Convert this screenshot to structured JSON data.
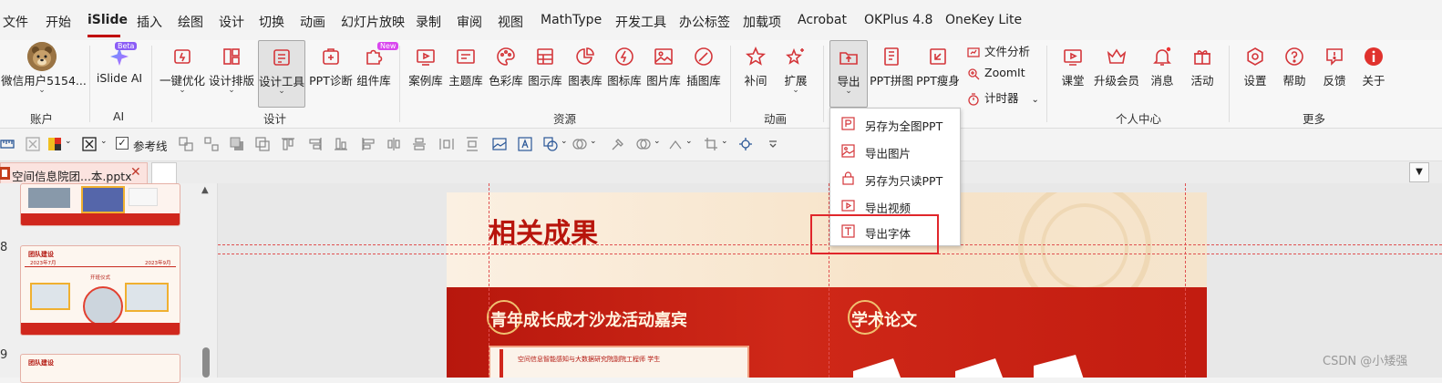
{
  "menu": {
    "tabs": [
      "文件",
      "开始",
      "iSlide",
      "插入",
      "绘图",
      "设计",
      "切换",
      "动画",
      "幻灯片放映",
      "录制",
      "审阅",
      "视图",
      "MathType",
      "开发工具",
      "办公标签",
      "加载项",
      "Acrobat",
      "OKPlus 4.8",
      "OneKey Lite"
    ],
    "active": "iSlide"
  },
  "ribbon": {
    "account": {
      "user": "微信用户5154...",
      "group": "账户"
    },
    "ai": {
      "label": "iSlide AI",
      "badge": "Beta",
      "group": "AI"
    },
    "design": {
      "one_key": "一键优化",
      "layout": "设计排版",
      "tools": "设计工具",
      "diag": "PPT诊断",
      "lib": "组件库",
      "new_badge": "New",
      "group": "设计"
    },
    "resources": {
      "items": [
        "案例库",
        "主题库",
        "色彩库",
        "图示库",
        "图表库",
        "图标库",
        "图片库",
        "插图库"
      ],
      "group": "资源"
    },
    "animation": {
      "items": [
        "补间",
        "扩展"
      ],
      "group": "动画"
    },
    "tools": {
      "export": "导出",
      "pin": "PPT拼图",
      "slim": "PPT瘦身",
      "analysis": "文件分析",
      "zoom": "ZoomIt",
      "timer": "计时器"
    },
    "personal": {
      "items": [
        "课堂",
        "升级会员",
        "消息",
        "活动"
      ],
      "group": "个人中心"
    },
    "more": {
      "items": [
        "设置",
        "帮助",
        "反馈",
        "关于"
      ],
      "group": "更多"
    }
  },
  "toolbar": {
    "guides": "参考线"
  },
  "filetab": {
    "name": "空间信息院团...本.pptx"
  },
  "thumbs": {
    "numbers": [
      "8",
      "9"
    ],
    "t1": "团队建设",
    "t1_date_l": "2023年7月",
    "t1_date_r": "2023年9月",
    "t1_mid": "开班仪式",
    "t2": "团队建设"
  },
  "slide": {
    "title": "相关成果",
    "left_heading": "青年成长成才沙龙活动嘉宾",
    "right_heading": "学术论文",
    "card_text": "空间信息智能感知与大数据研究院副院工程师 学生"
  },
  "export_menu": {
    "items": [
      "另存为全图PPT",
      "导出图片",
      "另存为只读PPT",
      "导出视频",
      "导出字体"
    ],
    "highlighted": "导出字体"
  },
  "watermark": "CSDN @小矮强",
  "colors": {
    "accent": "#c00000",
    "icon": "#d4363a",
    "slide_red": "#c81a12"
  }
}
